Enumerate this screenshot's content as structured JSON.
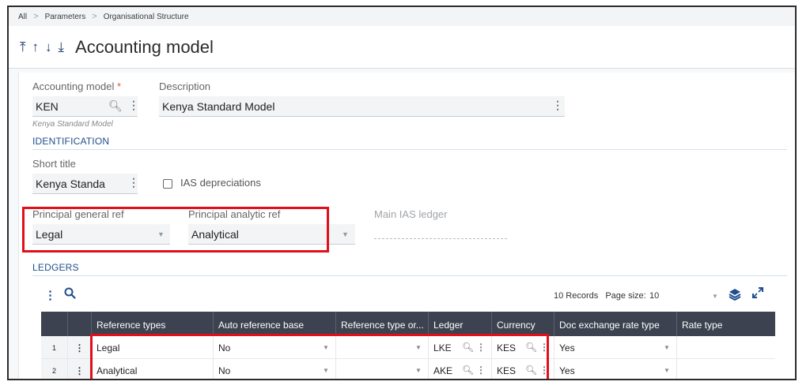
{
  "breadcrumb": [
    "All",
    "Parameters",
    "Organisational Structure"
  ],
  "header": {
    "title": "Accounting model",
    "nav": [
      "⤒",
      "↑",
      "↓",
      "⤓"
    ]
  },
  "form": {
    "accounting_model": {
      "label": "Accounting model",
      "required": "*",
      "value": "KEN",
      "hint": "Kenya Standard Model"
    },
    "description": {
      "label": "Description",
      "value": "Kenya Standard Model"
    },
    "identification_title": "IDENTIFICATION",
    "short_title": {
      "label": "Short title",
      "value": "Kenya Standa"
    },
    "ias_depreciations": {
      "label": "IAS depreciations",
      "checked": false
    },
    "principal_general_ref": {
      "label": "Principal general ref",
      "value": "Legal"
    },
    "principal_analytic_ref": {
      "label": "Principal analytic ref",
      "value": "Analytical"
    },
    "main_ias_ledger": {
      "label": "Main IAS ledger",
      "value": ""
    }
  },
  "ledgers": {
    "title": "LEDGERS",
    "records_text": "10 Records",
    "page_size_label": "Page size:",
    "page_size_value": "10",
    "columns": [
      "Reference types",
      "Auto reference base",
      "Reference type or...",
      "Ledger",
      "Currency",
      "Doc exchange rate type",
      "Rate type"
    ],
    "rows": [
      {
        "num": "1",
        "reference_type": "Legal",
        "auto_ref_base": "No",
        "ref_type_or": "",
        "ledger": "LKE",
        "currency": "KES",
        "doc_rate_type": "Yes",
        "rate_type": ""
      },
      {
        "num": "2",
        "reference_type": "Analytical",
        "auto_ref_base": "No",
        "ref_type_or": "",
        "ledger": "AKE",
        "currency": "KES",
        "doc_rate_type": "Yes",
        "rate_type": ""
      }
    ]
  },
  "colors": {
    "accent": "#1f4e8c",
    "highlight": "#e0101a",
    "header_bg": "#3c4250",
    "required": "#e35b1c"
  },
  "icons": [
    "search-icon",
    "more-icon",
    "dropdown-caret-icon",
    "layers-icon",
    "expand-icon"
  ]
}
